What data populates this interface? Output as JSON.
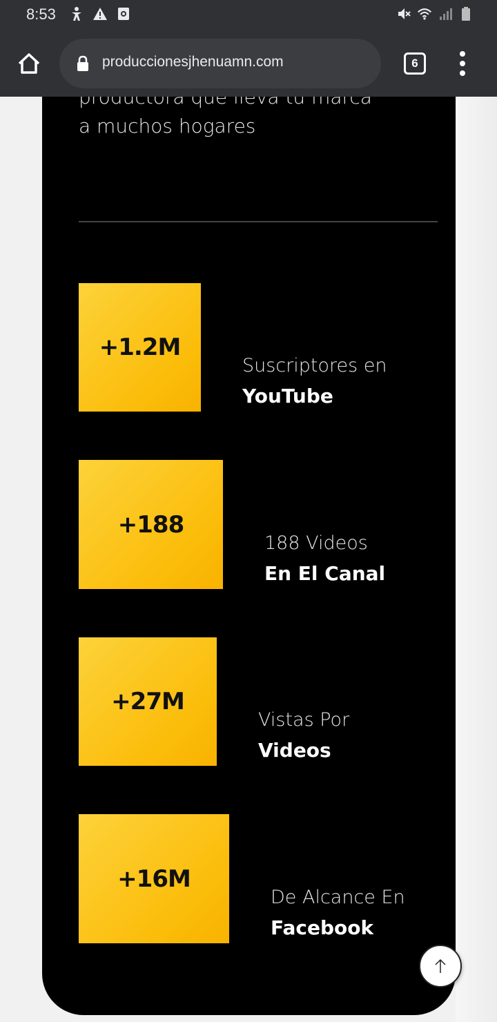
{
  "status_bar": {
    "time": "8:53",
    "left_icons": [
      "accessibility-icon",
      "warning-icon",
      "screen-record-icon"
    ],
    "right_icons": [
      "mute-icon",
      "wifi-icon",
      "signal-icon",
      "battery-icon"
    ]
  },
  "browser": {
    "url": "produccionesjhenuamn.com",
    "tab_count": "6"
  },
  "page": {
    "intro_line1": "productora que lleva tu marca",
    "intro_line2": "a muchos hogares",
    "stats": [
      {
        "value": "+1.2M",
        "label1": "Suscriptores en",
        "label2": "YouTube"
      },
      {
        "value": "+188",
        "label1": "188 Videos",
        "label2": "En El Canal"
      },
      {
        "value": "+27M",
        "label1": "Vistas Por",
        "label2": "Videos"
      },
      {
        "value": "+16M",
        "label1": "De Alcance En",
        "label2": "Facebook"
      }
    ]
  },
  "colors": {
    "accent_yellow": "#fbbd0b",
    "card_bg": "#000000",
    "chrome_bar": "#303134"
  }
}
